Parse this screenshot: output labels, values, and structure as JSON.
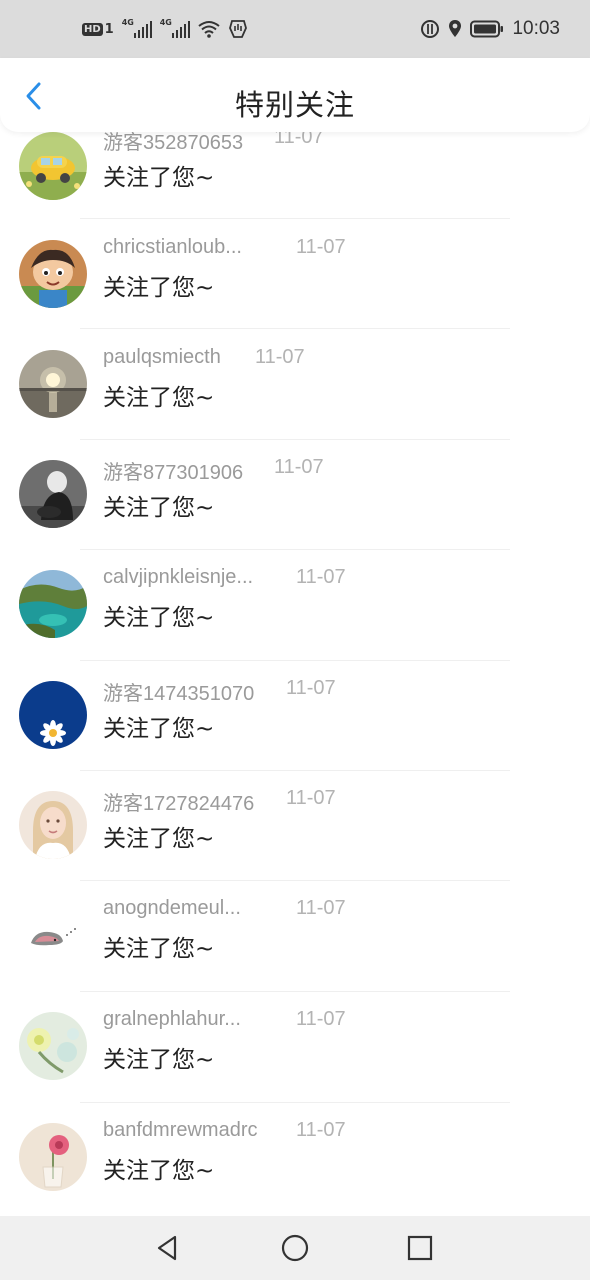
{
  "status_bar": {
    "hd_label": "HD",
    "sim_label": "1",
    "net1": "4G",
    "net2": "4G",
    "time": "10:03"
  },
  "header": {
    "title": "特别关注",
    "back_icon": "chevron-left-icon",
    "accent_color": "#2a8ee8"
  },
  "items": [
    {
      "name": "游客352870653",
      "date": "11-07",
      "message": "关注了您~",
      "avatar": "car-photo"
    },
    {
      "name": "chricstianloub...",
      "date": "11-07",
      "message": "关注了您~",
      "avatar": "cartoon-boy"
    },
    {
      "name": "paulqsmiecth",
      "date": "11-07",
      "message": "关注了您~",
      "avatar": "sunset-sea"
    },
    {
      "name": "游客877301906",
      "date": "11-07",
      "message": "关注了您~",
      "avatar": "dark-figure"
    },
    {
      "name": "calvjipnkleisnje...",
      "date": "11-07",
      "message": "关注了您~",
      "avatar": "coast-landscape"
    },
    {
      "name": "游客1474351070",
      "date": "11-07",
      "message": "关注了您~",
      "avatar": "blue-daisy"
    },
    {
      "name": "游客1727824476",
      "date": "11-07",
      "message": "关注了您~",
      "avatar": "portrait"
    },
    {
      "name": "anogndemeul...",
      "date": "11-07",
      "message": "关注了您~",
      "avatar": "sleepy-critter"
    },
    {
      "name": "gralnephlahur...",
      "date": "11-07",
      "message": "关注了您~",
      "avatar": "pastel-flowers"
    },
    {
      "name": "banfdmrewmadrc",
      "date": "11-07",
      "message": "关注了您~",
      "avatar": "pink-flower-vase"
    }
  ],
  "system_nav": {
    "back": "triangle-back-icon",
    "home": "circle-home-icon",
    "recent": "square-recent-icon"
  }
}
